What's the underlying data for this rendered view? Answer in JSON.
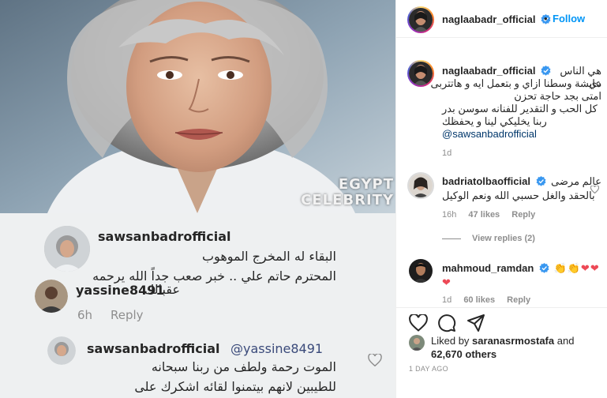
{
  "media": {
    "watermark_line1": "EGYPT",
    "watermark_line2": "CELEBRITY",
    "shot_comments": [
      {
        "username": "sawsanbadrofficial",
        "lines": [
          "البقاء له المخرج الموهوب",
          "المحترم حاتم علي .. خبر صعب جداً الله يرحمه"
        ]
      },
      {
        "username": "yassine8491",
        "text": "عقبالك",
        "time": "6h",
        "reply": "Reply"
      },
      {
        "username": "sawsanbadrofficial",
        "mention": "@yassine8491",
        "lines": [
          "الموت رحمة ولطف من ربنا سبحانه",
          "للطيبين لانهم بيتمنوا لقائه اشكرك على"
        ]
      }
    ]
  },
  "header": {
    "username": "naglaabadr_official",
    "follow_label": "Follow",
    "separator": "•"
  },
  "caption": {
    "username": "naglaabadr_official",
    "lines": [
      "هي الناس دي",
      "عايشة وسطنا ازاي و بتعمل ايه و هاتتربى",
      "امتى بجد حاجة تحزن",
      "كل الحب و التقدير للفنانه سوسن بدر",
      "ربنا يخليكي لينا و يحفظك"
    ],
    "mention": "@sawsanbadrofficial",
    "time": "1d"
  },
  "comments": [
    {
      "username": "badriatolbaofficial",
      "lines": [
        "عالم مرضى",
        "بالحقد والغل حسبي الله ونعم الوكيل"
      ],
      "time": "16h",
      "likes": "47 likes",
      "reply": "Reply",
      "view_replies": "View replies (2)"
    },
    {
      "username": "mahmoud_ramdan",
      "emoji": "👏👏❤❤❤",
      "time": "1d",
      "likes": "60 likes",
      "reply": "Reply"
    }
  ],
  "footer": {
    "liked_by_prefix": "Liked by",
    "liked_by_user": "saranasrmostafa",
    "liked_by_and": "and",
    "others": "62,670 others",
    "time": "1 DAY AGO"
  },
  "colors": {
    "accent": "#0095f6",
    "verified": "#3897f0",
    "heart": "#ed4956",
    "muted": "#8e8e8e"
  },
  "icons": [
    "heart-icon",
    "comment-icon",
    "share-icon",
    "verified-icon",
    "more-icon"
  ]
}
